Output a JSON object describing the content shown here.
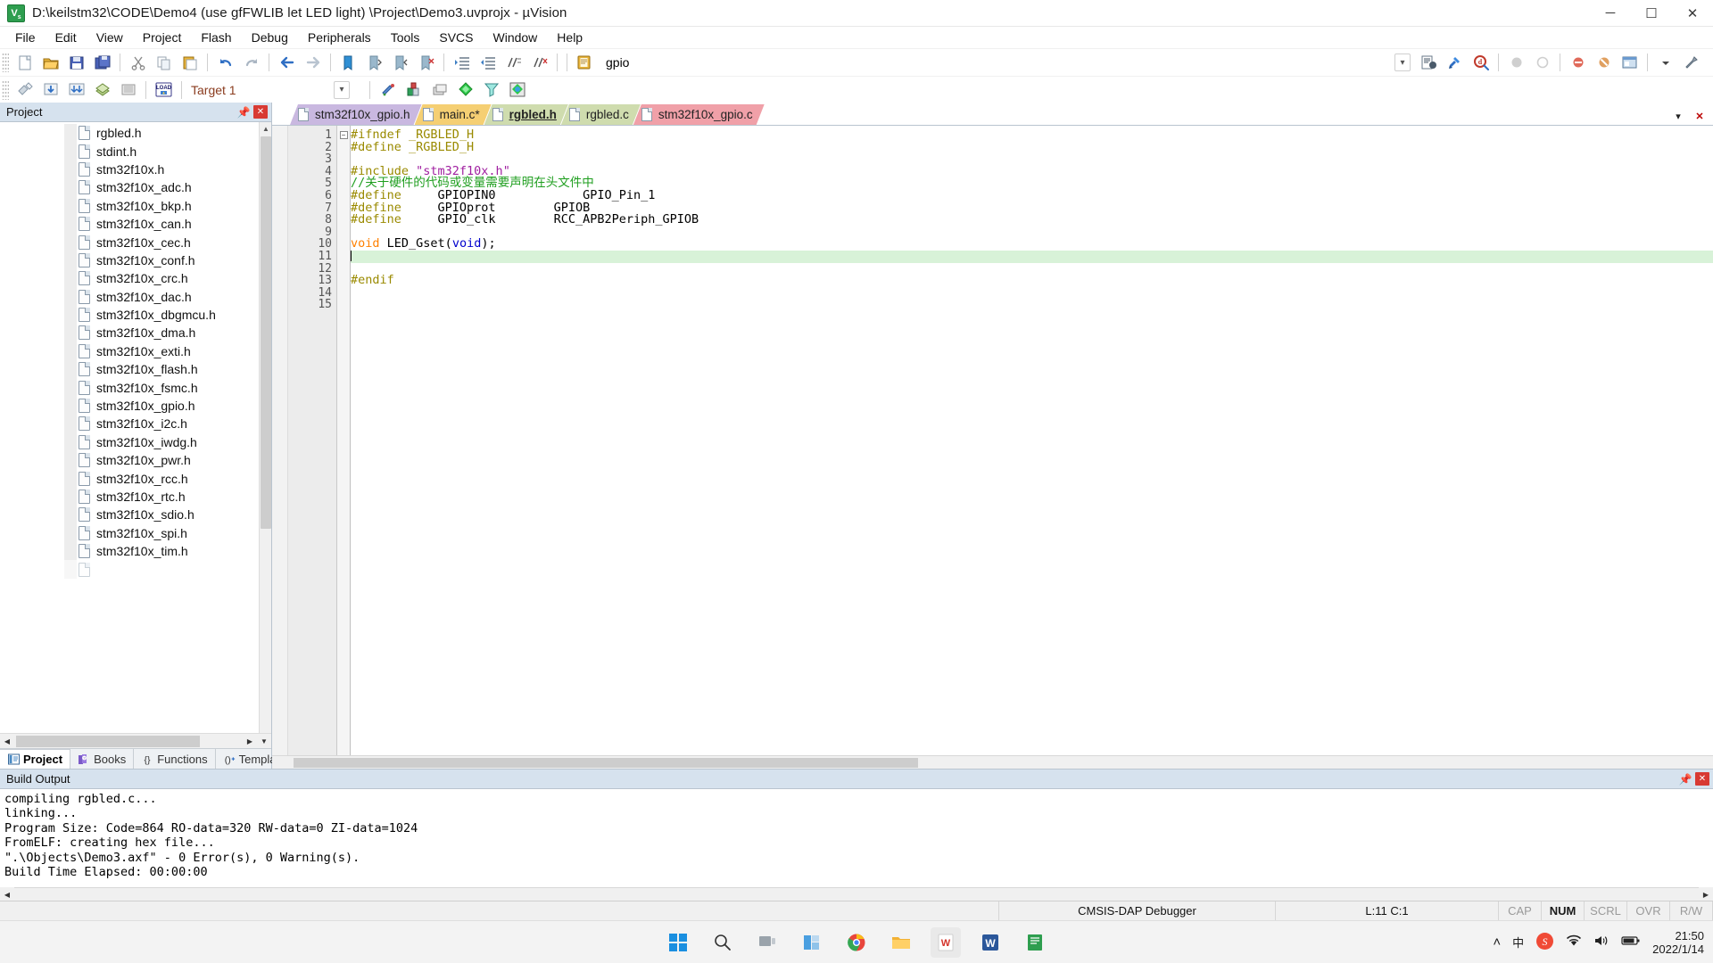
{
  "window": {
    "app_icon": "uvision-icon",
    "title": "D:\\keilstm32\\CODE\\Demo4  (use gfFWLIB let LED light)  \\Project\\Demo3.uvprojx - µVision",
    "minimize": "─",
    "maximize": "☐",
    "close": "✕"
  },
  "menu": {
    "items": [
      "File",
      "Edit",
      "View",
      "Project",
      "Flash",
      "Debug",
      "Peripherals",
      "Tools",
      "SVCS",
      "Window",
      "Help"
    ]
  },
  "toolbar_main": {
    "buttons": [
      {
        "name": "new-file-icon",
        "glyph": "📄"
      },
      {
        "name": "open-file-icon",
        "glyph": "📂"
      },
      {
        "name": "save-icon",
        "glyph": "💾"
      },
      {
        "name": "save-all-icon",
        "glyph": "💾"
      },
      {
        "name": "cut-icon",
        "glyph": "✂"
      },
      {
        "name": "copy-icon",
        "glyph": "⧉"
      },
      {
        "name": "paste-icon",
        "glyph": "📋"
      },
      {
        "name": "undo-icon",
        "glyph": "↶"
      },
      {
        "name": "redo-icon",
        "glyph": "↷"
      },
      {
        "name": "navigate-back-icon",
        "glyph": "←"
      },
      {
        "name": "navigate-forward-icon",
        "glyph": "→"
      },
      {
        "name": "bookmark-toggle-icon",
        "glyph": "⚑"
      },
      {
        "name": "bookmark-prev-icon",
        "glyph": "⚑"
      },
      {
        "name": "bookmark-next-icon",
        "glyph": "⚑"
      },
      {
        "name": "bookmark-clear-icon",
        "glyph": "⚑"
      },
      {
        "name": "indent-icon",
        "glyph": "⇥"
      },
      {
        "name": "outdent-icon",
        "glyph": "⇤"
      },
      {
        "name": "comment-icon",
        "glyph": "⫽"
      },
      {
        "name": "uncomment-icon",
        "glyph": "⫽"
      },
      {
        "name": "open-browse-icon",
        "glyph": "📖"
      }
    ],
    "search_value": "gpio",
    "search_placeholder": "",
    "right_buttons": [
      {
        "name": "browse-symbol-icon",
        "glyph": "🗎"
      },
      {
        "name": "find-in-files-icon",
        "glyph": "🔍"
      },
      {
        "name": "debug-magnifier-icon",
        "glyph": "🔎"
      },
      {
        "name": "breakpoint-icon",
        "glyph": "●"
      },
      {
        "name": "breakpoint-disable-icon",
        "glyph": "○"
      },
      {
        "name": "kill-breakpoints-icon",
        "glyph": "⛔"
      },
      {
        "name": "disable-breakpoints-icon",
        "glyph": "⛔"
      },
      {
        "name": "window-layout-icon",
        "glyph": "▤"
      },
      {
        "name": "layout-dropdown-icon",
        "glyph": "▾"
      },
      {
        "name": "configure-icon",
        "glyph": "🔧"
      }
    ]
  },
  "toolbar_build": {
    "buttons": [
      {
        "name": "translate-icon",
        "glyph": "◈"
      },
      {
        "name": "build-target-icon",
        "glyph": "↓"
      },
      {
        "name": "rebuild-all-icon",
        "glyph": "⇈"
      },
      {
        "name": "batch-build-icon",
        "glyph": "▥"
      },
      {
        "name": "stop-build-icon",
        "glyph": "▦"
      },
      {
        "name": "download-icon",
        "glyph": "LOAD"
      }
    ],
    "target_value": "Target 1",
    "after_buttons": [
      {
        "name": "target-options-icon",
        "glyph": "⚙"
      },
      {
        "name": "manage-project-items-icon",
        "glyph": "◬"
      },
      {
        "name": "manage-run-time-env-icon",
        "glyph": "⧉"
      },
      {
        "name": "pack-installer-icon",
        "glyph": "◆"
      },
      {
        "name": "filter-icon",
        "glyph": "▽"
      },
      {
        "name": "pack-icon",
        "glyph": "✧"
      }
    ]
  },
  "project_panel": {
    "title": "Project",
    "pin_icon": "pin-icon",
    "close_icon": "close-icon",
    "tree_items": [
      "rgbled.h",
      "stdint.h",
      "stm32f10x.h",
      "stm32f10x_adc.h",
      "stm32f10x_bkp.h",
      "stm32f10x_can.h",
      "stm32f10x_cec.h",
      "stm32f10x_conf.h",
      "stm32f10x_crc.h",
      "stm32f10x_dac.h",
      "stm32f10x_dbgmcu.h",
      "stm32f10x_dma.h",
      "stm32f10x_exti.h",
      "stm32f10x_flash.h",
      "stm32f10x_fsmc.h",
      "stm32f10x_gpio.h",
      "stm32f10x_i2c.h",
      "stm32f10x_iwdg.h",
      "stm32f10x_pwr.h",
      "stm32f10x_rcc.h",
      "stm32f10x_rtc.h",
      "stm32f10x_sdio.h",
      "stm32f10x_spi.h",
      "stm32f10x_tim.h"
    ],
    "tabs": [
      {
        "label": "Project",
        "icon": "project-icon",
        "active": true
      },
      {
        "label": "Books",
        "icon": "books-icon",
        "active": false
      },
      {
        "label": "Functions",
        "icon": "functions-icon",
        "active": false
      },
      {
        "label": "Templates",
        "icon": "templates-icon",
        "active": false
      }
    ]
  },
  "editor": {
    "tabs": [
      {
        "label": "stm32f10x_gpio.h",
        "color": "#c9b8e0",
        "active": false
      },
      {
        "label": "main.c*",
        "color": "#f5cf73",
        "active": false
      },
      {
        "label": "rgbled.h",
        "color": "#cfdcae",
        "active": true
      },
      {
        "label": "rgbled.c",
        "color": "#cfdcae",
        "active": false
      },
      {
        "label": "stm32f10x_gpio.c",
        "color": "#f0a0a8",
        "active": false
      }
    ],
    "tab_controls": {
      "dropdown": "▾",
      "close": "✕"
    },
    "line_numbers": [
      "1",
      "2",
      "3",
      "4",
      "5",
      "6",
      "7",
      "8",
      "9",
      "10",
      "11",
      "12",
      "13",
      "14",
      "15"
    ],
    "lines": [
      {
        "n": 1,
        "tokens": [
          {
            "t": "#ifndef _RGBLED_H",
            "c": "k-pre"
          }
        ]
      },
      {
        "n": 2,
        "tokens": [
          {
            "t": "#define _RGBLED_H",
            "c": "k-pre"
          }
        ]
      },
      {
        "n": 3,
        "tokens": [
          {
            "t": "",
            "c": "k-txt"
          }
        ]
      },
      {
        "n": 4,
        "tokens": [
          {
            "t": "#include ",
            "c": "k-pre"
          },
          {
            "t": "\"stm32f10x.h\"",
            "c": "k-str"
          }
        ]
      },
      {
        "n": 5,
        "tokens": [
          {
            "t": "//关于硬件的代码或变量需要声明在头文件中",
            "c": "k-cmt"
          }
        ]
      },
      {
        "n": 6,
        "tokens": [
          {
            "t": "#define ",
            "c": "k-pre"
          },
          {
            "t": "    GPIOPIN0            GPIO_Pin_1",
            "c": "k-txt"
          }
        ]
      },
      {
        "n": 7,
        "tokens": [
          {
            "t": "#define ",
            "c": "k-pre"
          },
          {
            "t": "    GPIOprot        GPIOB",
            "c": "k-txt"
          }
        ]
      },
      {
        "n": 8,
        "tokens": [
          {
            "t": "#define ",
            "c": "k-pre"
          },
          {
            "t": "    GPIO_clk        RCC_APB2Periph_GPIOB",
            "c": "k-txt"
          }
        ]
      },
      {
        "n": 9,
        "tokens": [
          {
            "t": "",
            "c": "k-txt"
          }
        ]
      },
      {
        "n": 10,
        "tokens": [
          {
            "t": "void",
            "c": "k-kw"
          },
          {
            "t": " LED_Gset",
            "c": "k-txt"
          },
          {
            "t": "(",
            "c": "k-txt"
          },
          {
            "t": "void",
            "c": "k-type"
          },
          {
            "t": ");",
            "c": "k-txt"
          }
        ]
      },
      {
        "n": 11,
        "tokens": [
          {
            "t": "",
            "c": "k-txt"
          }
        ],
        "highlight": true,
        "caret": true
      },
      {
        "n": 12,
        "tokens": [
          {
            "t": "",
            "c": "k-txt"
          }
        ]
      },
      {
        "n": 13,
        "tokens": [
          {
            "t": "#endif",
            "c": "k-pre"
          }
        ]
      },
      {
        "n": 14,
        "tokens": [
          {
            "t": "",
            "c": "k-txt"
          }
        ]
      },
      {
        "n": 15,
        "tokens": [
          {
            "t": "",
            "c": "k-txt"
          }
        ]
      }
    ]
  },
  "build_output": {
    "title": "Build Output",
    "lines": [
      "compiling rgbled.c...",
      "linking...",
      "Program Size: Code=864 RO-data=320 RW-data=0 ZI-data=1024",
      "FromELF: creating hex file...",
      "\".\\Objects\\Demo3.axf\" - 0 Error(s), 0 Warning(s).",
      "Build Time Elapsed:  00:00:00"
    ]
  },
  "statusbar": {
    "debugger": "CMSIS-DAP Debugger",
    "cursor": "L:11 C:1",
    "indicators": [
      {
        "label": "CAP",
        "on": false
      },
      {
        "label": "NUM",
        "on": true
      },
      {
        "label": "SCRL",
        "on": false
      },
      {
        "label": "OVR",
        "on": false
      },
      {
        "label": "R/W",
        "on": false
      }
    ]
  },
  "taskbar": {
    "items": [
      {
        "name": "start-button-icon",
        "glyph": "start"
      },
      {
        "name": "search-icon",
        "glyph": "search"
      },
      {
        "name": "task-view-icon",
        "glyph": "taskview"
      },
      {
        "name": "widgets-icon",
        "glyph": "widgets"
      },
      {
        "name": "chrome-icon",
        "glyph": "chrome"
      },
      {
        "name": "file-explorer-icon",
        "glyph": "explorer"
      },
      {
        "name": "wps-icon",
        "glyph": "wps"
      },
      {
        "name": "word-icon",
        "glyph": "word"
      },
      {
        "name": "notes-icon",
        "glyph": "notes"
      }
    ],
    "tray": {
      "overflow": "˄",
      "ime": "中",
      "sogou": "S",
      "wifi": "wifi-icon",
      "volume": "volume-icon",
      "battery": "battery-icon",
      "time": "21:50",
      "date": "2022/1/14"
    }
  }
}
